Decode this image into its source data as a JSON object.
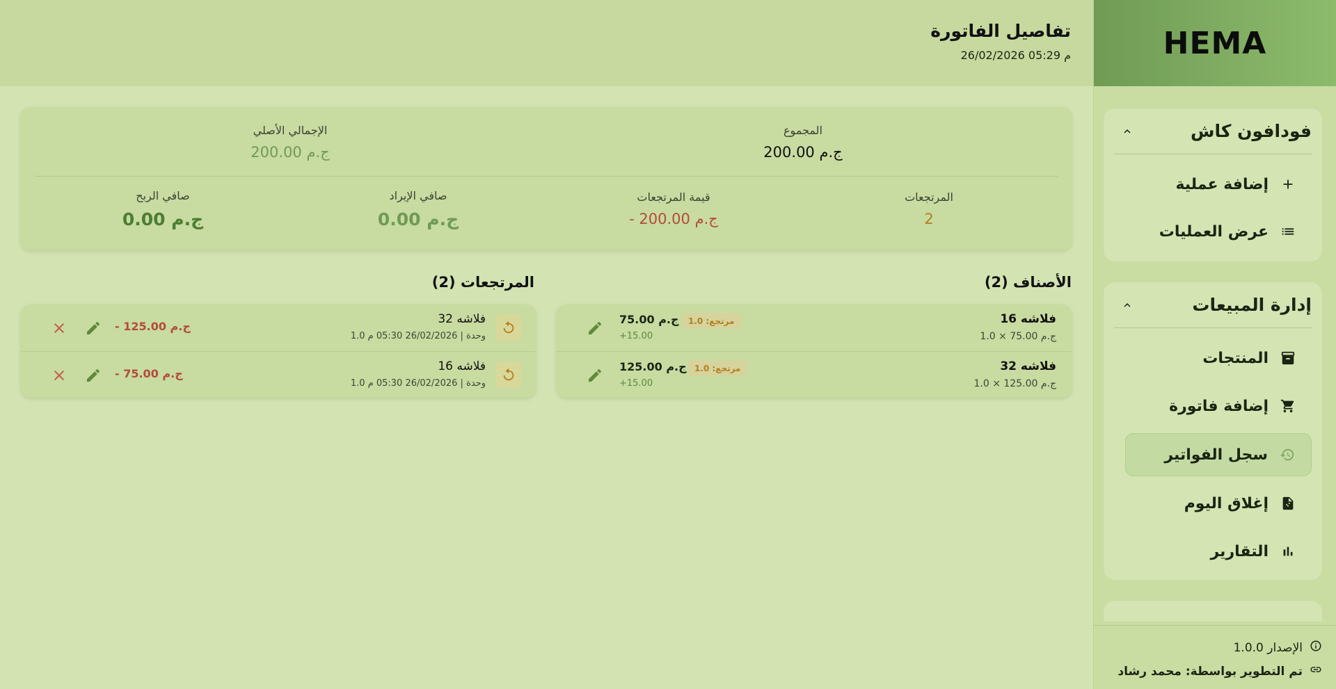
{
  "app": {
    "brand": "HEMA"
  },
  "header": {
    "title": "تفاصيل الفاتورة",
    "date": "26/02/2026 05:29 م"
  },
  "summary": {
    "total_label": "المجموع",
    "total_value": "200.00 ج.م",
    "original_label": "الإجمالي الأصلي",
    "original_value": "200.00 ج.م",
    "returns_label": "المرتجعات",
    "returns_value": "2",
    "returns_amount_label": "قيمة المرتجعات",
    "returns_amount_value": "- 200.00 ج.م",
    "net_revenue_label": "صافي الإيراد",
    "net_revenue_value": "0.00 ج.م",
    "net_profit_label": "صافي الربح",
    "net_profit_value": "0.00 ج.م"
  },
  "items": {
    "title": "الأصناف (2)",
    "rows": [
      {
        "name": "فلاشه 16",
        "sub": "1.0 × 75.00 ج.م",
        "price": "75.00 ج.م",
        "profit": "+15.00",
        "badge": "مرتجع: 1.0"
      },
      {
        "name": "فلاشه 32",
        "sub": "1.0 × 125.00 ج.م",
        "price": "125.00 ج.م",
        "profit": "+15.00",
        "badge": "مرتجع: 1.0"
      }
    ]
  },
  "returns": {
    "title": "المرتجعات (2)",
    "rows": [
      {
        "name": "فلاشه 32",
        "sub": "1.0 وحدة | 26/02/2026 05:30 م",
        "amount": "- 125.00 ج.م"
      },
      {
        "name": "فلاشه 16",
        "sub": "1.0 وحدة | 26/02/2026 05:30 م",
        "amount": "- 75.00 ج.م"
      }
    ]
  },
  "sidebar": {
    "group1": {
      "title": "فودافون كاش",
      "items": [
        {
          "label": "إضافة عملية",
          "icon": "plus-icon"
        },
        {
          "label": "عرض العمليات",
          "icon": "list-icon"
        }
      ]
    },
    "group2": {
      "title": "إدارة المبيعات",
      "items": [
        {
          "label": "المنتجات",
          "icon": "archive-icon"
        },
        {
          "label": "إضافة فاتورة",
          "icon": "cart-icon"
        },
        {
          "label": "سجل الفواتير",
          "icon": "history-icon",
          "active": true
        },
        {
          "label": "إغلاق اليوم",
          "icon": "document-icon"
        },
        {
          "label": "التقارير",
          "icon": "bar-chart-icon"
        }
      ]
    },
    "footer": {
      "version": "الإصدار 1.0.0",
      "developer": "تم التطوير بواسطة: محمد رشاد"
    }
  },
  "colors": {
    "accent_green": "#5e8a3c",
    "muted_green": "#6f9b55",
    "danger": "#b24b3c",
    "warning": "#b27f22"
  }
}
